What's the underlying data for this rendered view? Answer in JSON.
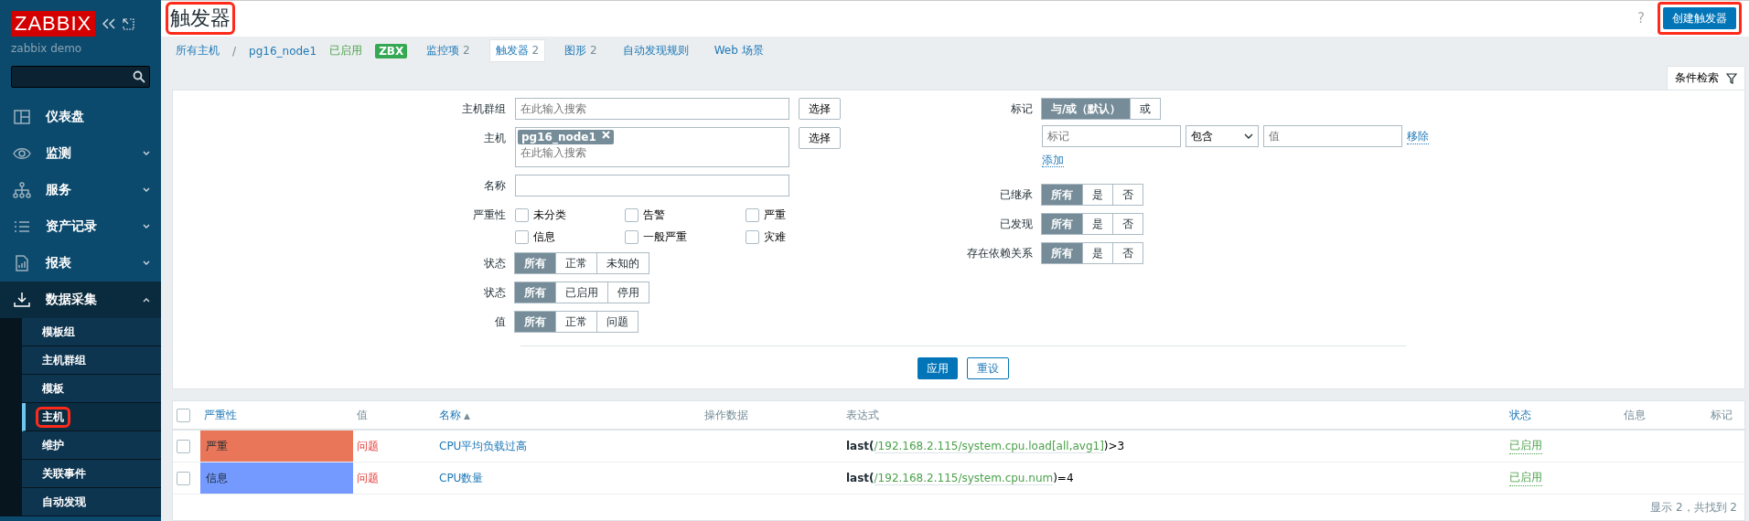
{
  "sidebar": {
    "logo": "ZABBIX",
    "server_name": "zabbix demo",
    "menu": [
      {
        "label": "仪表盘",
        "expandable": false,
        "expanded": false
      },
      {
        "label": "监测",
        "expandable": true,
        "expanded": false
      },
      {
        "label": "服务",
        "expandable": true,
        "expanded": false
      },
      {
        "label": "资产记录",
        "expandable": true,
        "expanded": false
      },
      {
        "label": "报表",
        "expandable": true,
        "expanded": false
      },
      {
        "label": "数据采集",
        "expandable": true,
        "expanded": true,
        "children": [
          {
            "label": "模板组",
            "selected": false,
            "highlighted": false
          },
          {
            "label": "主机群组",
            "selected": false,
            "highlighted": false
          },
          {
            "label": "模板",
            "selected": false,
            "highlighted": false
          },
          {
            "label": "主机",
            "selected": true,
            "highlighted": true
          },
          {
            "label": "维护",
            "selected": false,
            "highlighted": false
          },
          {
            "label": "关联事件",
            "selected": false,
            "highlighted": false
          },
          {
            "label": "自动发现",
            "selected": false,
            "highlighted": false
          }
        ]
      }
    ]
  },
  "header": {
    "title": "触发器",
    "title_highlighted": true,
    "help": "?",
    "create_button": "创建触发器",
    "create_highlighted": true
  },
  "nav": {
    "all_hosts": "所有主机",
    "separator": "/",
    "host": "pg16_node1",
    "status": "已启用",
    "zbx": "ZBX",
    "tabs": [
      {
        "label": "监控项",
        "count": "2",
        "selected": false
      },
      {
        "label": "触发器",
        "count": "2",
        "selected": true
      },
      {
        "label": "图形",
        "count": "2",
        "selected": false
      },
      {
        "label": "自动发现规则",
        "selected": false
      },
      {
        "label": "Web 场景",
        "selected": false
      }
    ]
  },
  "filter_tab": "条件检索",
  "filter": {
    "host_groups": {
      "label": "主机群组",
      "placeholder": "在此输入搜索",
      "button": "选择"
    },
    "hosts": {
      "label": "主机",
      "chip": "pg16_node1",
      "placeholder": "在此输入搜索",
      "button": "选择"
    },
    "name": {
      "label": "名称"
    },
    "severity": {
      "label": "严重性",
      "options": [
        {
          "label": "未分类",
          "checked": false
        },
        {
          "label": "告警",
          "checked": false
        },
        {
          "label": "严重",
          "checked": false
        },
        {
          "label": "信息",
          "checked": false
        },
        {
          "label": "一般严重",
          "checked": false
        },
        {
          "label": "灾难",
          "checked": false
        }
      ]
    },
    "left_radios": [
      {
        "label": "状态",
        "options": [
          {
            "label": "所有",
            "selected": true
          },
          {
            "label": "正常",
            "selected": false
          },
          {
            "label": "未知的",
            "selected": false
          }
        ]
      },
      {
        "label": "状态",
        "options": [
          {
            "label": "所有",
            "selected": true
          },
          {
            "label": "已启用",
            "selected": false
          },
          {
            "label": "停用",
            "selected": false
          }
        ]
      },
      {
        "label": "值",
        "options": [
          {
            "label": "所有",
            "selected": true
          },
          {
            "label": "正常",
            "selected": false
          },
          {
            "label": "问题",
            "selected": false
          }
        ]
      }
    ],
    "tags": {
      "label": "标记",
      "options": [
        {
          "label": "与/或（默认）",
          "selected": true
        },
        {
          "label": "或",
          "selected": false
        }
      ],
      "tag_placeholder": "标记",
      "operator": "包含",
      "value_placeholder": "值",
      "remove": "移除",
      "add": "添加"
    },
    "right_radios": [
      {
        "label": "已继承",
        "options": [
          {
            "label": "所有",
            "selected": true
          },
          {
            "label": "是",
            "selected": false
          },
          {
            "label": "否",
            "selected": false
          }
        ]
      },
      {
        "label": "已发现",
        "options": [
          {
            "label": "所有",
            "selected": true
          },
          {
            "label": "是",
            "selected": false
          },
          {
            "label": "否",
            "selected": false
          }
        ]
      },
      {
        "label": "存在依赖关系",
        "options": [
          {
            "label": "所有",
            "selected": true
          },
          {
            "label": "是",
            "selected": false
          },
          {
            "label": "否",
            "selected": false
          }
        ]
      }
    ],
    "apply": "应用",
    "reset": "重设"
  },
  "table": {
    "select_all_checked": false,
    "columns": [
      {
        "label": "严重性",
        "link": true
      },
      {
        "label": "值",
        "link": false
      },
      {
        "label": "名称",
        "link": true,
        "sort": "▲"
      },
      {
        "label": "操作数据",
        "link": false
      },
      {
        "label": "表达式",
        "link": false
      },
      {
        "label": "状态",
        "link": true
      },
      {
        "label": "信息",
        "link": false
      },
      {
        "label": "标记",
        "link": false
      }
    ],
    "rows": [
      {
        "checked": false,
        "severity": "严重",
        "color": "#e97659",
        "value": "问题",
        "name": "CPU平均负载过高",
        "expression": {
          "func": "last(",
          "item": "/192.168.2.115/system.cpu.load[all,avg1]",
          "rest": ")>3"
        },
        "status": "已启用"
      },
      {
        "checked": false,
        "severity": "信息",
        "color": "#7499ff",
        "value": "问题",
        "name": "CPU数量",
        "expression": {
          "func": "last(",
          "item": "/192.168.2.115/system.cpu.num",
          "rest": ")=4"
        },
        "status": "已启用"
      }
    ],
    "footer": "显示 2，共找到 2"
  }
}
